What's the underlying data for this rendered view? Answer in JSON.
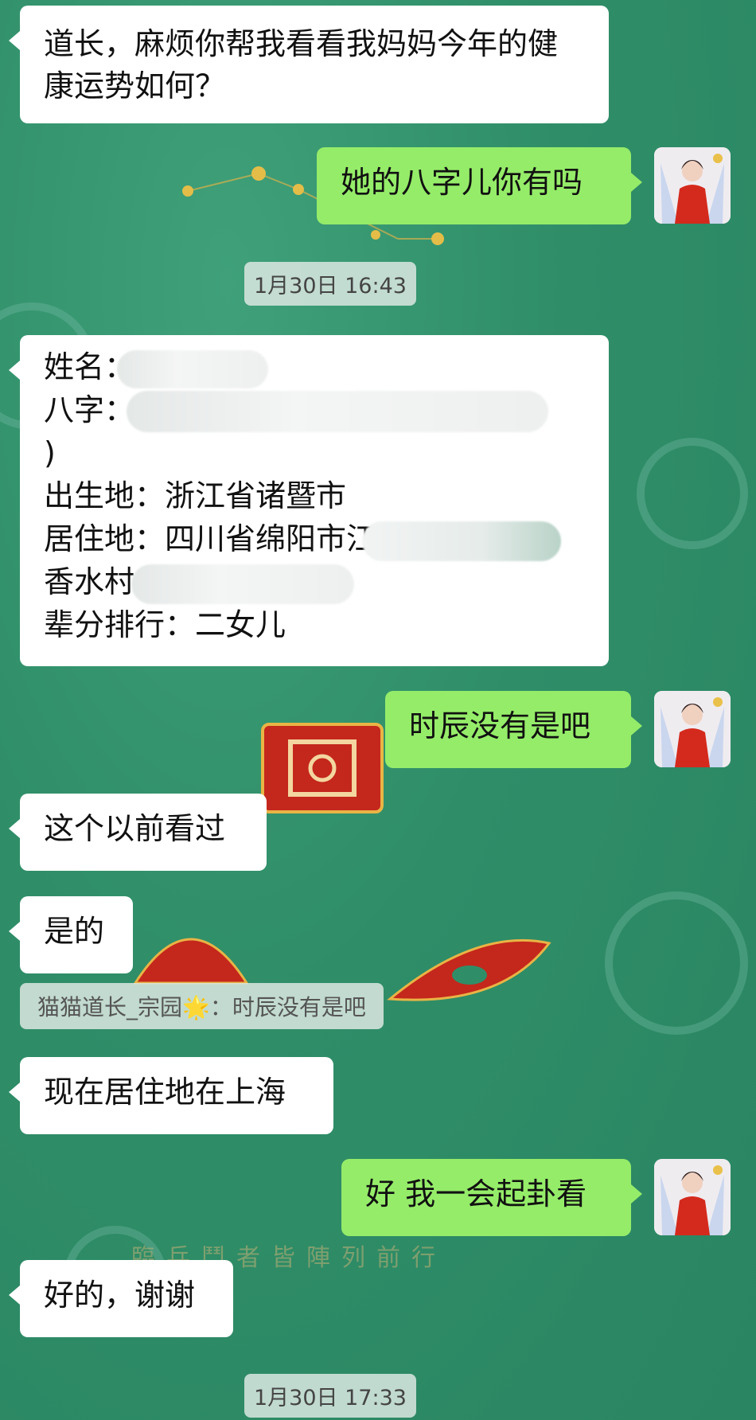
{
  "messages": [
    {
      "side": "left",
      "text": "道长，麻烦你帮我看看我妈妈今年的健康运势如何？"
    },
    {
      "side": "right",
      "text": "她的八字儿你有吗"
    },
    {
      "side": "right",
      "text": "时辰没有是吧"
    },
    {
      "side": "left",
      "text": "这个以前看过"
    },
    {
      "side": "left",
      "text": "是的"
    },
    {
      "side": "left",
      "text": "现在居住地在上海"
    },
    {
      "side": "right",
      "text": "好 我一会起卦看"
    },
    {
      "side": "left",
      "text": "好的，谢谢"
    }
  ],
  "info_card": {
    "name_label": "姓名：",
    "bazi_label": "八字：",
    "bazi_tail": ")",
    "birthplace": "出生地：浙江省诸暨市",
    "residence": "居住地：四川省绵阳市江",
    "village": "香水村",
    "rank": "辈分排行：二女儿"
  },
  "timestamps": [
    "1月30日 16:43",
    "1月30日 17:33"
  ],
  "quote": {
    "prefix": "猫猫道长_宗园",
    "star": "🌟",
    "suffix": "：时辰没有是吧"
  },
  "background_text": "臨兵鬥者皆陣列前行",
  "colors": {
    "sent_bubble": "#95ec69",
    "received_bubble": "#ffffff",
    "chat_background": "#2f8e68"
  }
}
